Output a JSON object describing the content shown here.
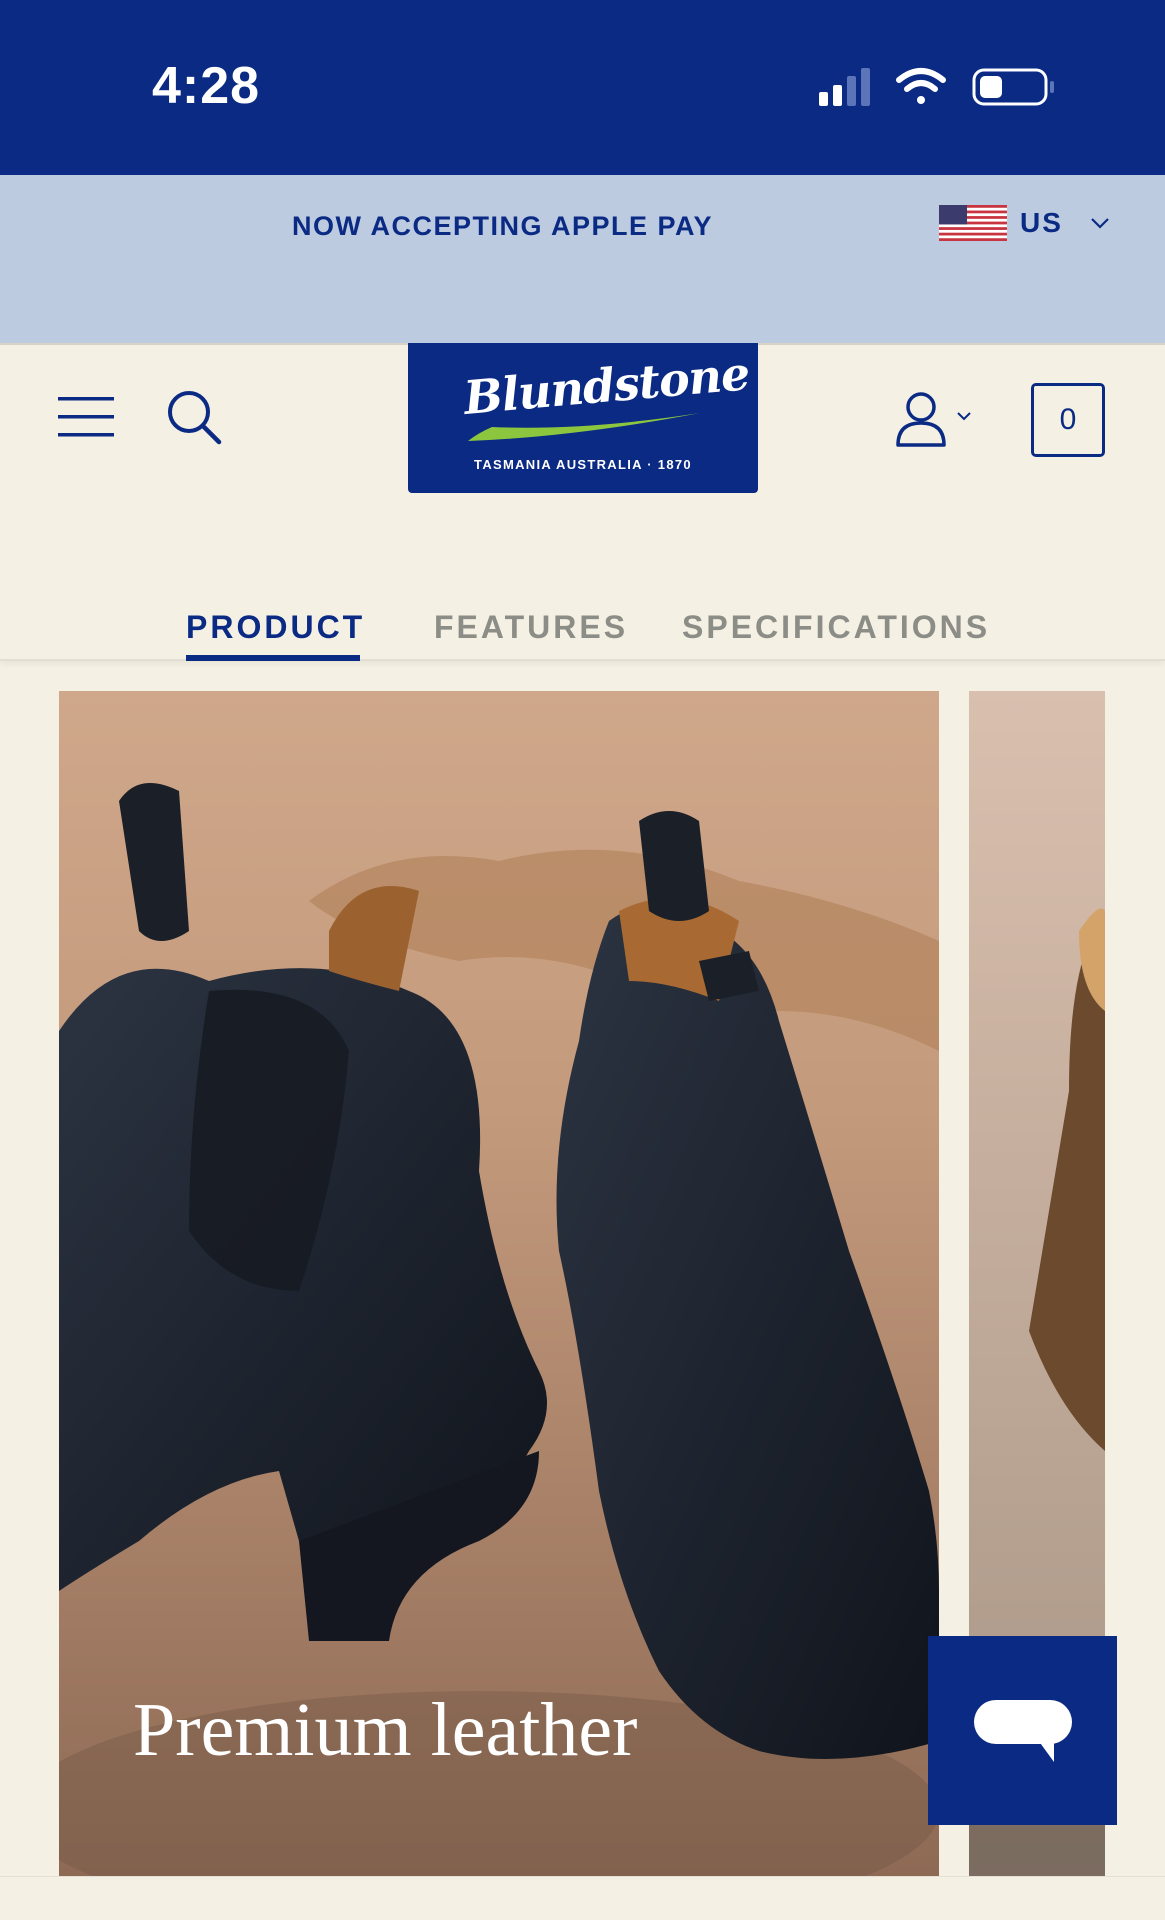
{
  "status_bar": {
    "time": "4:28"
  },
  "promo": {
    "text": "NOW ACCEPTING APPLE PAY"
  },
  "region": {
    "code": "US"
  },
  "header": {
    "logo": {
      "name": "Blundstone",
      "tagline": "TASMANIA AUSTRALIA · 1870"
    },
    "cart_count": "0"
  },
  "tabs": [
    {
      "label": "PRODUCT",
      "active": true
    },
    {
      "label": "FEATURES",
      "active": false
    },
    {
      "label": "SPECIFICATIONS",
      "active": false
    }
  ],
  "carousel": {
    "slides": [
      {
        "caption": "Premium leather"
      }
    ]
  },
  "colors": {
    "brand_navy": "#0a2a84",
    "promo_bg": "#bccbdf",
    "page_bg": "#f4f0e4",
    "logo_swoosh": "#8cc63f",
    "tab_inactive": "#8b8d86"
  },
  "icons": {
    "menu": "hamburger-icon",
    "search": "search-icon",
    "account": "user-icon",
    "chat": "chat-bubble-icon",
    "region_chevron": "chevron-down-icon"
  }
}
